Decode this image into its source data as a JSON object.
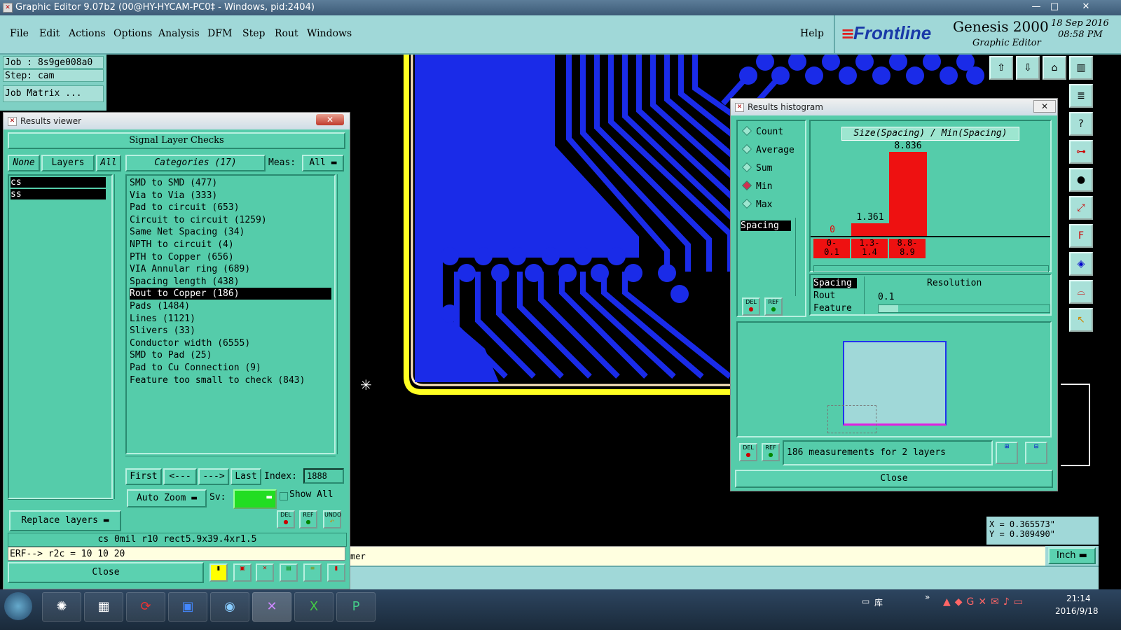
{
  "window": {
    "title": "Graphic Editor 9.07b2 (00@HY-HYCAM-PC0‡ - Windows, pid:2404)",
    "minimize": "—",
    "maximize": "□",
    "close": "✕"
  },
  "menu": {
    "items": [
      "File",
      "Edit",
      "Actions",
      "Options",
      "Analysis",
      "DFM",
      "Step",
      "Rout",
      "Windows"
    ],
    "help": "Help"
  },
  "brand": {
    "logo": "Frontline",
    "product": "Genesis 2000",
    "subtitle": "Graphic Editor",
    "date": "18 Sep 2016",
    "time": "08:58 PM"
  },
  "job": {
    "job": "Job : 8s9ge008a0",
    "step": "Step: cam",
    "matrix": "Job Matrix ..."
  },
  "results_viewer": {
    "title": "Results viewer",
    "header": "Signal Layer Checks",
    "none": "None",
    "layers_btn": "Layers",
    "all": "All",
    "categories": "Categories (17)",
    "meas_label": "Meas:",
    "meas_value": "All",
    "layers": [
      "cs",
      "ss"
    ],
    "items": [
      "SMD to SMD (477)",
      "Via to Via (333)",
      "Pad to circuit (653)",
      "Circuit to circuit (1259)",
      "Same Net Spacing (34)",
      "NPTH to circuit (4)",
      "PTH to Copper (656)",
      "VIA Annular ring (689)",
      "Spacing length (438)",
      "Rout to Copper (186)",
      "Pads (1484)",
      "Lines (1121)",
      "Slivers (33)",
      "Conductor width (6555)",
      "SMD to Pad (25)",
      "Pad to Cu Connection (9)",
      "Feature too small to check (843)"
    ],
    "selected_index": 9,
    "nav": {
      "first": "First",
      "prev": "<---",
      "next": "--->",
      "last": "Last",
      "index_label": "Index:",
      "index_value": "1888"
    },
    "auto_zoom": "Auto Zoom",
    "sv_label": "Sv:",
    "show_all": "Show All",
    "replace_layers": "Replace layers",
    "del": "DEL",
    "ref": "REF",
    "undo": "UNDO",
    "status": "cs 0mil  r10  rect5.9x39.4xr1.5",
    "erf": "ERF--> r2c = 10 10 20",
    "close": "Close"
  },
  "histogram": {
    "title": "Results histogram",
    "options": [
      "Count",
      "Average",
      "Sum",
      "Min",
      "Max"
    ],
    "selected_option": "Min",
    "list_item": "Spacing",
    "chart_title": "Size(Spacing) / Min(Spacing)",
    "bins": [
      {
        "label_top": "0-",
        "label_bottom": "0.1",
        "value": "0"
      },
      {
        "label_top": "1.3-",
        "label_bottom": "1.4",
        "value": "1.361"
      },
      {
        "label_top": "8.8-",
        "label_bottom": "8.9",
        "value": "8.836"
      }
    ],
    "size_options": [
      "Spacing",
      "Rout",
      "Feature"
    ],
    "resolution_label": "Resolution",
    "resolution_value": "0.1",
    "measurements": "186 measurements for 2 layers",
    "close": "Close",
    "del": "DEL",
    "ref": "REF"
  },
  "canvas": {
    "crosshair": "✳",
    "message_fragment": "mer"
  },
  "coords": {
    "x": "X = 0.365573\"",
    "y": "Y = 0.309490\""
  },
  "units": "Inch",
  "taskbar": {
    "clock_time": "21:14",
    "clock_date": "2016/9/18",
    "lib": "库"
  },
  "colors": {
    "copper": "#1a2be8",
    "teal": "#55ccaa",
    "bar": "#ee1111",
    "outline": "#ffff22"
  }
}
